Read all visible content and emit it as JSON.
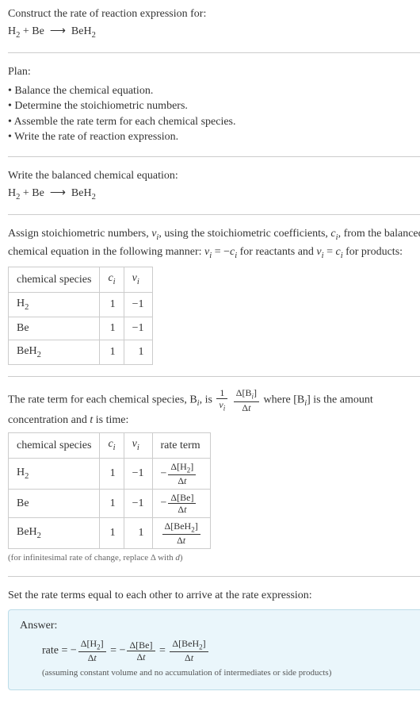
{
  "header": {
    "title": "Construct the rate of reaction expression for:",
    "equation_html": "H<span class='sub'>2</span> + Be&nbsp;&nbsp;⟶&nbsp;&nbsp;BeH<span class='sub'>2</span>"
  },
  "plan": {
    "heading": "Plan:",
    "items": [
      "• Balance the chemical equation.",
      "• Determine the stoichiometric numbers.",
      "• Assemble the rate term for each chemical species.",
      "• Write the rate of reaction expression."
    ]
  },
  "balanced": {
    "heading": "Write the balanced chemical equation:",
    "equation_html": "H<span class='sub'>2</span> + Be&nbsp;&nbsp;⟶&nbsp;&nbsp;BeH<span class='sub'>2</span>"
  },
  "assign_text_html": "Assign stoichiometric numbers, <span class='ital'>ν<span class='sub'>i</span></span>, using the stoichiometric coefficients, <span class='ital'>c<span class='sub'>i</span></span>, from the balanced chemical equation in the following manner: <span class='ital'>ν<span class='sub'>i</span></span> = −<span class='ital'>c<span class='sub'>i</span></span> for reactants and <span class='ital'>ν<span class='sub'>i</span></span> = <span class='ital'>c<span class='sub'>i</span></span> for products:",
  "stoich_table": {
    "headers": [
      "chemical species",
      "c_i_html",
      "nu_i_html"
    ],
    "hdr_species": "chemical species",
    "hdr_ci_html": "<span class='ital'>c<span class='sub'>i</span></span>",
    "hdr_nui_html": "<span class='ital'>ν<span class='sub'>i</span></span>",
    "rows": [
      {
        "species_html": "H<span class='sub'>2</span>",
        "ci": "1",
        "nui": "−1"
      },
      {
        "species_html": "Be",
        "ci": "1",
        "nui": "−1"
      },
      {
        "species_html": "BeH<span class='sub'>2</span>",
        "ci": "1",
        "nui": "1"
      }
    ]
  },
  "rate_intro_html": "The rate term for each chemical species, B<span class='sub'><span class='ital'>i</span></span>, is <span class='frac'><span class='num'>1</span><span class='den'><span class='ital'>ν<span class='sub'>i</span></span></span></span> <span class='frac'><span class='num'>Δ[B<span class='sub'><span class='ital'>i</span></span>]</span><span class='den'>Δ<span class='ital'>t</span></span></span> where [B<span class='sub'><span class='ital'>i</span></span>] is the amount concentration and <span class='ital'>t</span> is time:",
  "rate_table": {
    "hdr_species": "chemical species",
    "hdr_ci_html": "<span class='ital'>c<span class='sub'>i</span></span>",
    "hdr_nui_html": "<span class='ital'>ν<span class='sub'>i</span></span>",
    "hdr_rateterm": "rate term",
    "rows": [
      {
        "species_html": "H<span class='sub'>2</span>",
        "ci": "1",
        "nui": "−1",
        "rate_html": "−<span class='frac'><span class='num'>Δ[H<span class=\"sub\">2</span>]</span><span class='den'>Δ<span class=\"ital\">t</span></span></span>"
      },
      {
        "species_html": "Be",
        "ci": "1",
        "nui": "−1",
        "rate_html": "−<span class='frac'><span class='num'>Δ[Be]</span><span class='den'>Δ<span class=\"ital\">t</span></span></span>"
      },
      {
        "species_html": "BeH<span class='sub'>2</span>",
        "ci": "1",
        "nui": "1",
        "rate_html": "<span class='frac'><span class='num'>Δ[BeH<span class=\"sub\">2</span>]</span><span class='den'>Δ<span class=\"ital\">t</span></span></span>"
      }
    ],
    "note_html": "(for infinitesimal rate of change, replace Δ with <span class='ital'>d</span>)"
  },
  "set_equal_text": "Set the rate terms equal to each other to arrive at the rate expression:",
  "answer": {
    "title": "Answer:",
    "rate_html": "rate = −<span class='frac'><span class='num'>Δ[H<span class=\"sub\">2</span>]</span><span class='den'>Δ<span class=\"ital\">t</span></span></span> = −<span class='frac'><span class='num'>Δ[Be]</span><span class='den'>Δ<span class=\"ital\">t</span></span></span> = <span class='frac'><span class='num'>Δ[BeH<span class=\"sub\">2</span>]</span><span class='den'>Δ<span class=\"ital\">t</span></span></span>",
    "assumption": "(assuming constant volume and no accumulation of intermediates or side products)"
  }
}
